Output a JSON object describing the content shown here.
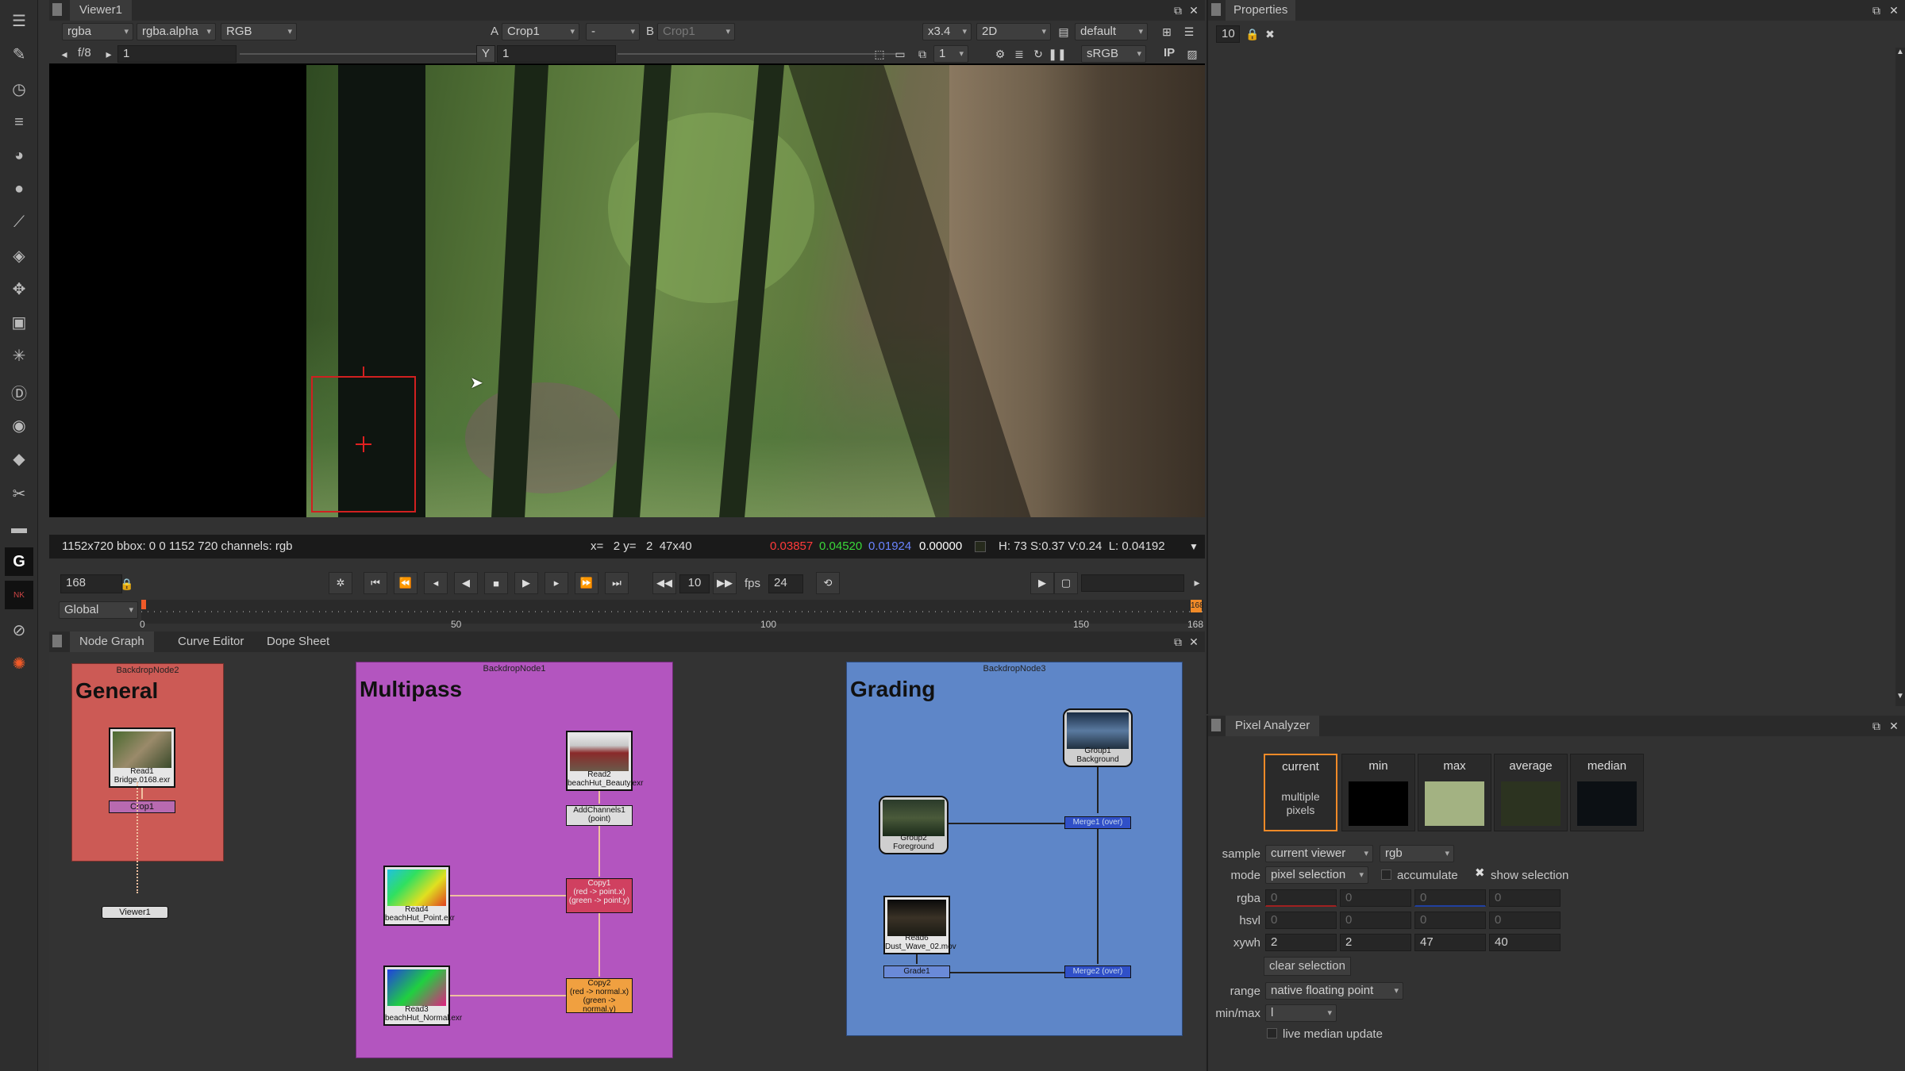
{
  "colors": {
    "accent": "#f08a28",
    "general_backdrop": "#cc5a55",
    "multipass_backdrop": "#b355bf",
    "grading_backdrop": "#5e86c8",
    "red_readout": "#ff3a3a",
    "green_readout": "#3ad83a",
    "blue_readout": "#4a6cff"
  },
  "viewer": {
    "tab": "Viewer1",
    "channels": "rgba",
    "alpha_channel": "rgba.alpha",
    "colorspace_mode": "RGB",
    "a_label": "A",
    "a_input": "Crop1",
    "op": "-",
    "b_label": "B",
    "b_input": "Crop1",
    "zoom": "x3.4",
    "view_mode": "2D",
    "lut": "default",
    "fstop": "f/8",
    "gain": "1",
    "y_label": "Y",
    "gamma": "1",
    "proxy": "1",
    "display": "sRGB",
    "ip": "IP",
    "info": {
      "format": "1152x720 bbox: 0 0 1152 720 channels: rgb",
      "coords": "x=   2 y=   2  47x40",
      "r": "0.03857",
      "g": "0.04520",
      "b": "0.01924",
      "a": "0.00000",
      "hsv": "H: 73 S:0.37 V:0.24  L: 0.04192"
    }
  },
  "timeline": {
    "frame": "168",
    "scope": "Global",
    "step": "10",
    "fps_label": "fps",
    "fps": "24",
    "end_frame": "168",
    "ticks": [
      "0",
      "50",
      "100",
      "150",
      "168"
    ]
  },
  "node_graph": {
    "tabs": [
      "Node Graph",
      "Curve Editor",
      "Dope Sheet"
    ],
    "backdrops": {
      "general": {
        "name": "BackdropNode2",
        "label": "General"
      },
      "multipass": {
        "name": "BackdropNode1",
        "label": "Multipass"
      },
      "grading": {
        "name": "BackdropNode3",
        "label": "Grading"
      }
    },
    "nodes": {
      "read1": {
        "name": "Read1",
        "file": "Bridge.0168.exr"
      },
      "crop1": "Crop1",
      "viewer1": "Viewer1",
      "read2": {
        "name": "Read2",
        "file": "beachHut_Beauty.exr"
      },
      "addchannels": {
        "name": "AddChannels1",
        "sub": "(point)"
      },
      "copy1": {
        "name": "Copy1",
        "l1": "(red -> point.x)",
        "l2": "(green -> point.y)"
      },
      "copy2": {
        "name": "Copy2",
        "l1": "(red -> normal.x)",
        "l2": "(green -> normal.y)"
      },
      "read4": {
        "name": "Read4",
        "file": "beachHut_Point.exr"
      },
      "read3": {
        "name": "Read3",
        "file": "beachHut_Normal.exr"
      },
      "group1": {
        "name": "Group1",
        "sub": "Background"
      },
      "group2": {
        "name": "Group2",
        "sub": "Foreground"
      },
      "merge1": "Merge1 (over)",
      "read6": {
        "name": "Read6",
        "file": "Dust_Wave_02.mov"
      },
      "grade1": "Grade1",
      "merge2": "Merge2 (over)"
    }
  },
  "properties": {
    "title": "Properties",
    "max_panels": "10"
  },
  "pixel_analyzer": {
    "title": "Pixel Analyzer",
    "boxes": {
      "current": "current",
      "current_text": "multiple pixels",
      "min": "min",
      "max": "max",
      "average": "average",
      "median": "median"
    },
    "sample_label": "sample",
    "sample_value": "current viewer",
    "sample_channels": "rgb",
    "mode_label": "mode",
    "mode_value": "pixel selection",
    "accumulate": "accumulate",
    "show_selection": "show selection",
    "rgba_label": "rgba",
    "rgba": [
      "0",
      "0",
      "0",
      "0"
    ],
    "hsvl_label": "hsvl",
    "hsvl": [
      "0",
      "0",
      "0",
      "0"
    ],
    "xywh_label": "xywh",
    "xywh": [
      "2",
      "2",
      "47",
      "40"
    ],
    "clear_selection": "clear selection",
    "range_label": "range",
    "range_value": "native floating point",
    "minmax_label": "min/max",
    "minmax_value": "l",
    "live_median": "live median update"
  }
}
